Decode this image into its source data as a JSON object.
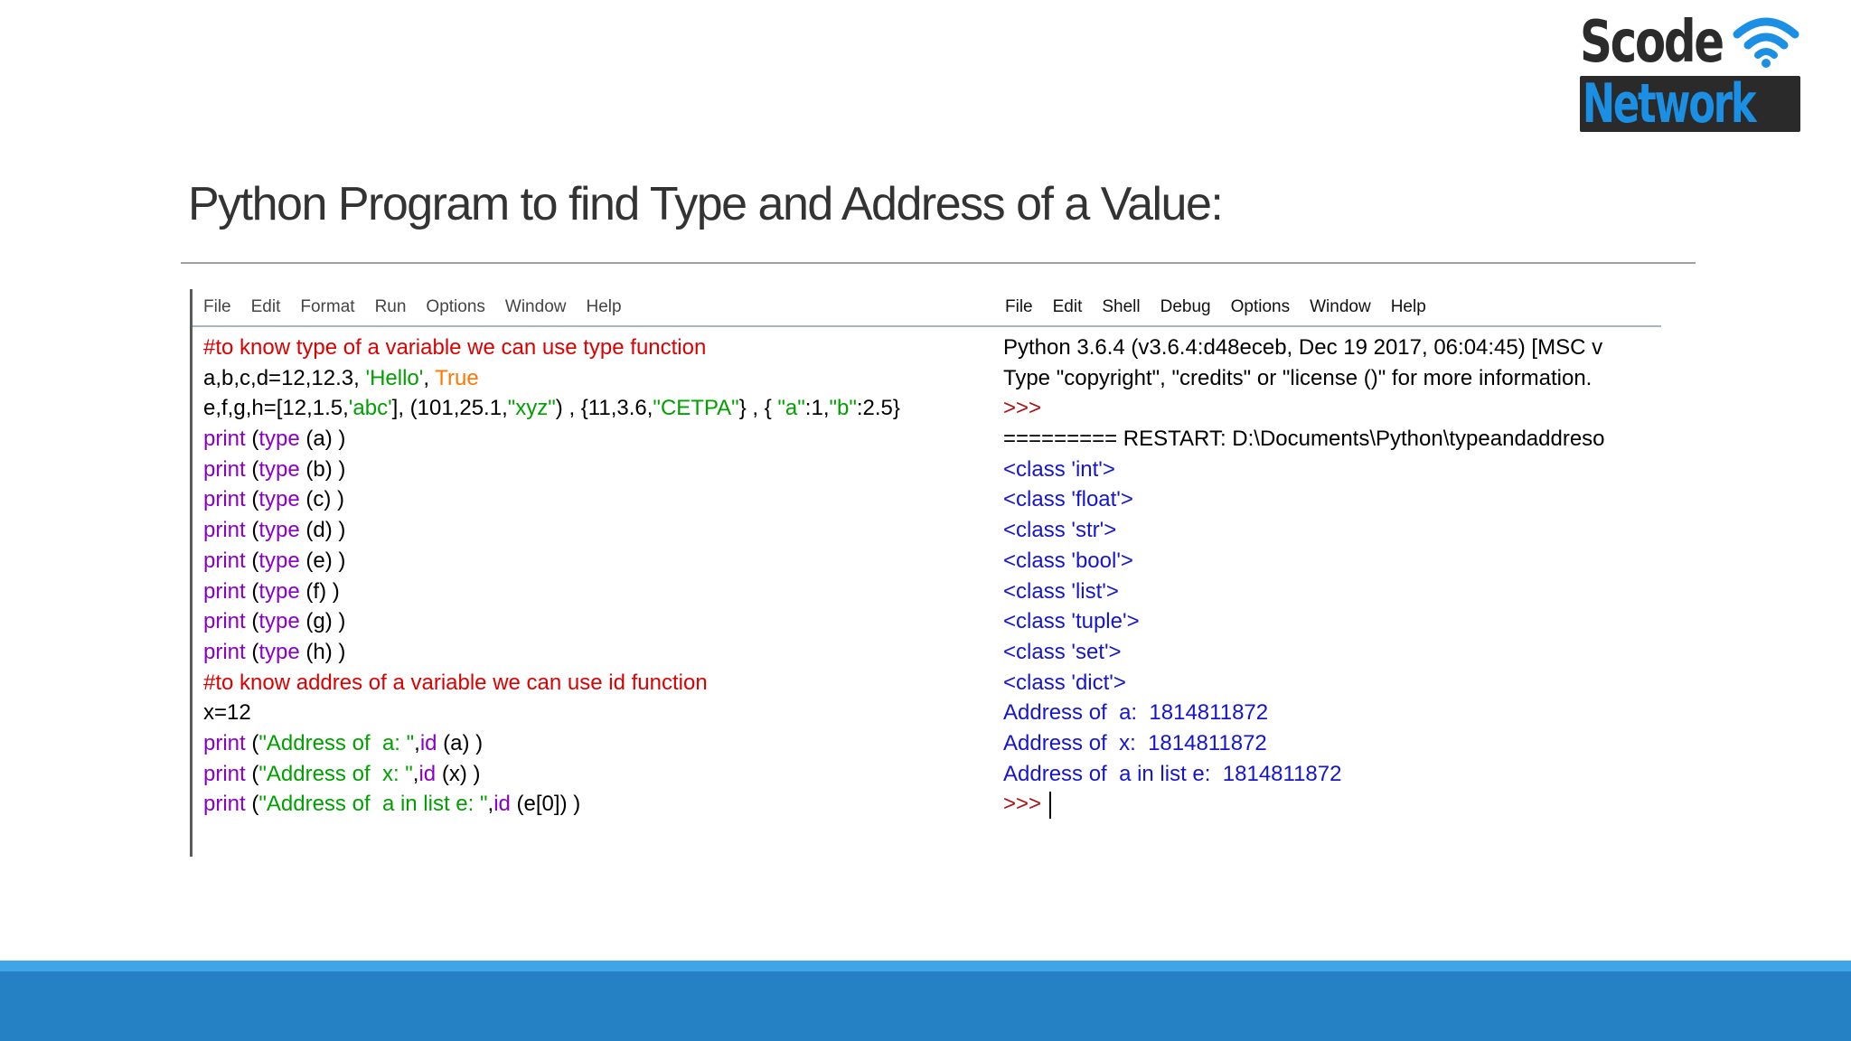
{
  "logo": {
    "line1": "Scode",
    "line2": "Network",
    "colors": {
      "dark": "#2b2b2b",
      "blue": "#1a8fe3",
      "plate": "#2a2a2a"
    }
  },
  "title": "Python Program to find Type and Address of a Value:",
  "editor": {
    "menu": [
      "File",
      "Edit",
      "Format",
      "Run",
      "Options",
      "Window",
      "Help"
    ],
    "lines": [
      [
        {
          "t": "#to know type of a variable we can use type function",
          "c": "comment"
        }
      ],
      [
        {
          "t": "a,b,c,d=12,12.3, ",
          "c": "plain"
        },
        {
          "t": "'Hello'",
          "c": "string"
        },
        {
          "t": ", ",
          "c": "plain"
        },
        {
          "t": "True",
          "c": "bool"
        }
      ],
      [
        {
          "t": "e,f,g,h=[12,1.5,",
          "c": "plain"
        },
        {
          "t": "'abc'",
          "c": "string"
        },
        {
          "t": "], (101,25.1,",
          "c": "plain"
        },
        {
          "t": "\"xyz\"",
          "c": "string"
        },
        {
          "t": ") , {11,3.6,",
          "c": "plain"
        },
        {
          "t": "\"CETPA\"",
          "c": "string"
        },
        {
          "t": "} , { ",
          "c": "plain"
        },
        {
          "t": "\"a\"",
          "c": "string"
        },
        {
          "t": ":1,",
          "c": "plain"
        },
        {
          "t": "\"b\"",
          "c": "string"
        },
        {
          "t": ":2.5}",
          "c": "plain"
        }
      ],
      [
        {
          "t": "print",
          "c": "keyword"
        },
        {
          "t": " (",
          "c": "plain"
        },
        {
          "t": "type",
          "c": "keyword"
        },
        {
          "t": " (a) )",
          "c": "plain"
        }
      ],
      [
        {
          "t": "print",
          "c": "keyword"
        },
        {
          "t": " (",
          "c": "plain"
        },
        {
          "t": "type",
          "c": "keyword"
        },
        {
          "t": " (b) )",
          "c": "plain"
        }
      ],
      [
        {
          "t": "print",
          "c": "keyword"
        },
        {
          "t": " (",
          "c": "plain"
        },
        {
          "t": "type",
          "c": "keyword"
        },
        {
          "t": " (c) )",
          "c": "plain"
        }
      ],
      [
        {
          "t": "print",
          "c": "keyword"
        },
        {
          "t": " (",
          "c": "plain"
        },
        {
          "t": "type",
          "c": "keyword"
        },
        {
          "t": " (d) )",
          "c": "plain"
        }
      ],
      [
        {
          "t": "print",
          "c": "keyword"
        },
        {
          "t": " (",
          "c": "plain"
        },
        {
          "t": "type",
          "c": "keyword"
        },
        {
          "t": " (e) )",
          "c": "plain"
        }
      ],
      [
        {
          "t": "print",
          "c": "keyword"
        },
        {
          "t": " (",
          "c": "plain"
        },
        {
          "t": "type",
          "c": "keyword"
        },
        {
          "t": " (f) )",
          "c": "plain"
        }
      ],
      [
        {
          "t": "print",
          "c": "keyword"
        },
        {
          "t": " (",
          "c": "plain"
        },
        {
          "t": "type",
          "c": "keyword"
        },
        {
          "t": " (g) )",
          "c": "plain"
        }
      ],
      [
        {
          "t": "print",
          "c": "keyword"
        },
        {
          "t": " (",
          "c": "plain"
        },
        {
          "t": "type",
          "c": "keyword"
        },
        {
          "t": " (h) )",
          "c": "plain"
        }
      ],
      [
        {
          "t": "#to know addres of a variable we can use id function",
          "c": "comment"
        }
      ],
      [
        {
          "t": "x=12",
          "c": "plain"
        }
      ],
      [
        {
          "t": "print",
          "c": "keyword"
        },
        {
          "t": " (",
          "c": "plain"
        },
        {
          "t": "\"Address of  a: \"",
          "c": "string"
        },
        {
          "t": ",",
          "c": "plain"
        },
        {
          "t": "id",
          "c": "keyword"
        },
        {
          "t": " (a) )",
          "c": "plain"
        }
      ],
      [
        {
          "t": "print",
          "c": "keyword"
        },
        {
          "t": " (",
          "c": "plain"
        },
        {
          "t": "\"Address of  x: \"",
          "c": "string"
        },
        {
          "t": ",",
          "c": "plain"
        },
        {
          "t": "id",
          "c": "keyword"
        },
        {
          "t": " (x) )",
          "c": "plain"
        }
      ],
      [
        {
          "t": "print",
          "c": "keyword"
        },
        {
          "t": " (",
          "c": "plain"
        },
        {
          "t": "\"Address of  a in list e: \"",
          "c": "string"
        },
        {
          "t": ",",
          "c": "plain"
        },
        {
          "t": "id",
          "c": "keyword"
        },
        {
          "t": " (e[0]) )",
          "c": "plain"
        }
      ]
    ]
  },
  "shell": {
    "menu": [
      "File",
      "Edit",
      "Shell",
      "Debug",
      "Options",
      "Window",
      "Help"
    ],
    "lines": [
      [
        {
          "t": "Python 3.6.4 (v3.6.4:d48eceb, Dec 19 2017, 06:04:45) [MSC v",
          "c": "plain"
        }
      ],
      [
        {
          "t": "Type \"copyright\", \"credits\" or \"license ()\" for more information.",
          "c": "plain"
        }
      ],
      [
        {
          "t": ">>>",
          "c": "prompt"
        }
      ],
      [
        {
          "t": "========= RESTART: D:\\Documents\\Python\\typeandaddreso",
          "c": "plain"
        }
      ],
      [
        {
          "t": "<class 'int'>",
          "c": "out"
        }
      ],
      [
        {
          "t": "<class 'float'>",
          "c": "out"
        }
      ],
      [
        {
          "t": "<class 'str'>",
          "c": "out"
        }
      ],
      [
        {
          "t": "<class 'bool'>",
          "c": "out"
        }
      ],
      [
        {
          "t": "<class 'list'>",
          "c": "out"
        }
      ],
      [
        {
          "t": "<class 'tuple'>",
          "c": "out"
        }
      ],
      [
        {
          "t": "<class 'set'>",
          "c": "out"
        }
      ],
      [
        {
          "t": "<class 'dict'>",
          "c": "out"
        }
      ],
      [
        {
          "t": "Address of  a:  1814811872",
          "c": "out"
        }
      ],
      [
        {
          "t": "Address of  x:  1814811872",
          "c": "out"
        }
      ],
      [
        {
          "t": "Address of  a in list e:  1814811872",
          "c": "out"
        }
      ],
      [
        {
          "t": ">>> ",
          "c": "prompt"
        }
      ]
    ]
  },
  "colors": {
    "comment": "#dd0000",
    "keyword": "#8a00c8",
    "string": "#00a000",
    "bool": "#ff7700",
    "output": "#1515d0",
    "footer": "#2581c4",
    "footer_strip": "#3fa5e6"
  }
}
